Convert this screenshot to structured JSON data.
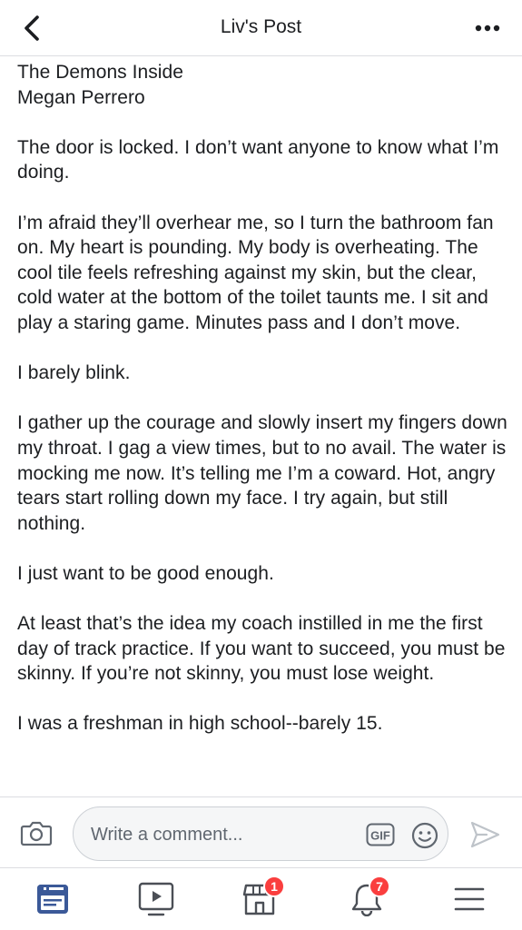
{
  "header": {
    "title": "Liv's Post",
    "back_icon": "chevron-left-icon",
    "more_icon": "more-horizontal-icon"
  },
  "post": {
    "paragraphs": [
      "The Demons Inside\nMegan Perrero",
      "The door is locked. I don’t want anyone to know what I’m doing.",
      "I’m afraid they’ll overhear me, so I turn the bathroom fan on. My heart is pounding. My body is overheating. The cool tile feels refreshing against my skin, but the clear, cold water at the bottom of the toilet taunts me. I sit and play a staring game. Minutes pass and I don’t move.",
      "I barely blink.",
      "I gather up the courage and slowly insert my fingers down my throat. I gag a view times, but to no avail. The water is mocking me now. It’s telling me I’m a coward. Hot, angry tears start rolling down my face. I try again, but still nothing.",
      "I just want to be good enough.",
      "At least that’s the idea my coach instilled in me the first day of track practice. If you want to succeed, you must be skinny. If you’re not skinny, you must lose weight.",
      "I was a freshman in high school--barely 15."
    ]
  },
  "comment_bar": {
    "placeholder": "Write a comment...",
    "gif_label": "GIF",
    "icons": [
      "camera-icon",
      "gif-icon",
      "emoji-icon",
      "send-icon"
    ]
  },
  "tab_bar": {
    "tabs": [
      {
        "name": "news-feed",
        "icon": "news-feed-icon",
        "active": true,
        "badge": null
      },
      {
        "name": "watch",
        "icon": "video-play-icon",
        "active": false,
        "badge": null
      },
      {
        "name": "marketplace",
        "icon": "marketplace-icon",
        "active": false,
        "badge": "1"
      },
      {
        "name": "notifications",
        "icon": "bell-icon",
        "active": false,
        "badge": "7"
      },
      {
        "name": "menu",
        "icon": "hamburger-menu-icon",
        "active": false,
        "badge": null
      }
    ]
  },
  "colors": {
    "accent": "#3b5998",
    "badge": "#fa3e3e",
    "icon_gray": "#4b4f56",
    "text": "#1c1e21",
    "placeholder": "#606770"
  }
}
